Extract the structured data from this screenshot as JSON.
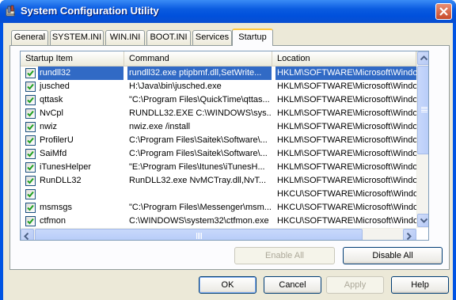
{
  "window": {
    "title": "System Configuration Utility"
  },
  "tabs": [
    {
      "label": "General"
    },
    {
      "label": "SYSTEM.INI"
    },
    {
      "label": "WIN.INI"
    },
    {
      "label": "BOOT.INI"
    },
    {
      "label": "Services"
    },
    {
      "label": "Startup"
    }
  ],
  "active_tab": "Startup",
  "list": {
    "columns": [
      "Startup Item",
      "Command",
      "Location"
    ],
    "rows": [
      {
        "item": "rundll32",
        "command": "rundll32.exe ptipbmf.dll,SetWrite...",
        "location": "HKLM\\SOFTWARE\\Microsoft\\Windows\\",
        "checked": true,
        "selected": true
      },
      {
        "item": "jusched",
        "command": "H:\\Java\\bin\\jusched.exe",
        "location": "HKLM\\SOFTWARE\\Microsoft\\Windows\\",
        "checked": true
      },
      {
        "item": "qttask",
        "command": "\"C:\\Program Files\\QuickTime\\qttas...",
        "location": "HKLM\\SOFTWARE\\Microsoft\\Windows\\",
        "checked": true
      },
      {
        "item": "NvCpl",
        "command": "RUNDLL32.EXE C:\\WINDOWS\\sys...",
        "location": "HKLM\\SOFTWARE\\Microsoft\\Windows\\",
        "checked": true
      },
      {
        "item": "nwiz",
        "command": "nwiz.exe /install",
        "location": "HKLM\\SOFTWARE\\Microsoft\\Windows\\",
        "checked": true
      },
      {
        "item": "ProfilerU",
        "command": "C:\\Program Files\\Saitek\\Software\\...",
        "location": "HKLM\\SOFTWARE\\Microsoft\\Windows\\",
        "checked": true
      },
      {
        "item": "SaiMfd",
        "command": "C:\\Program Files\\Saitek\\Software\\...",
        "location": "HKLM\\SOFTWARE\\Microsoft\\Windows\\",
        "checked": true
      },
      {
        "item": "iTunesHelper",
        "command": "\"E:\\Program Files\\Itunes\\iTunesH...",
        "location": "HKLM\\SOFTWARE\\Microsoft\\Windows\\",
        "checked": true
      },
      {
        "item": "RunDLL32",
        "command": "RunDLL32.exe NvMCTray.dll,NvT...",
        "location": "HKLM\\SOFTWARE\\Microsoft\\Windows\\",
        "checked": true
      },
      {
        "item": "",
        "command": "",
        "location": "HKCU\\SOFTWARE\\Microsoft\\Windows\\",
        "checked": true
      },
      {
        "item": "msmsgs",
        "command": "\"C:\\Program Files\\Messenger\\msm...",
        "location": "HKCU\\SOFTWARE\\Microsoft\\Windows\\",
        "checked": true
      },
      {
        "item": "ctfmon",
        "command": "C:\\WINDOWS\\system32\\ctfmon.exe",
        "location": "HKCU\\SOFTWARE\\Microsoft\\Windows\\",
        "checked": true
      }
    ]
  },
  "panel_buttons": {
    "enable_all": "Enable All",
    "disable_all": "Disable All"
  },
  "dialog_buttons": {
    "ok": "OK",
    "cancel": "Cancel",
    "apply": "Apply",
    "help": "Help"
  },
  "icons": {
    "app": "system-config-icon",
    "close": "close-icon",
    "check": "check-icon",
    "scroll_up": "arrow-up-icon",
    "scroll_down": "arrow-down-icon",
    "scroll_left": "arrow-left-icon",
    "scroll_right": "arrow-right-icon"
  },
  "colors": {
    "title_bar": "#0054e3",
    "selection": "#316ac5",
    "dialog_face": "#ece9d8",
    "active_tab_accent": "#ffc83c",
    "check_green": "#21a121"
  }
}
